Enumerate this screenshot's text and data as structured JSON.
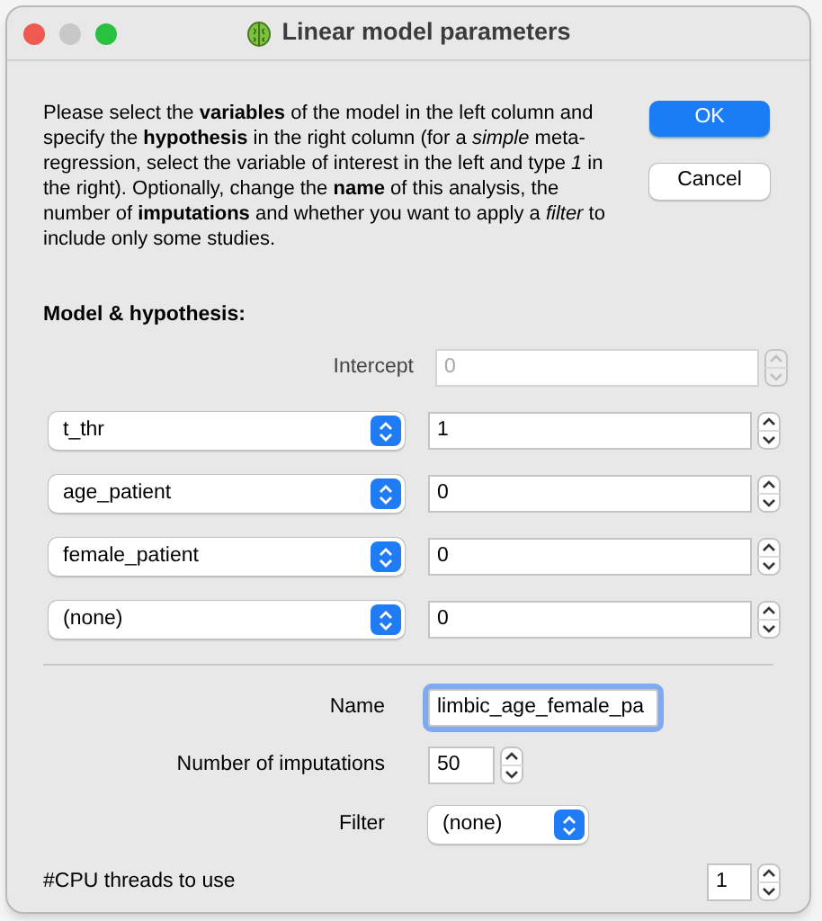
{
  "window": {
    "title": "Linear model parameters"
  },
  "description": "Please select the **variables** of the model in the left column and specify the **hypothesis** in the right column (for a *simple* meta-regression, select the variable of interest in the left and type *1* in the right). Optionally, change the **name** of this analysis, the number of **imputations** and whether you want to apply a *filter* to include only some studies.",
  "buttons": [
    {
      "label": "OK",
      "default": true
    },
    {
      "label": "Cancel",
      "default": false
    }
  ],
  "section_title": "Model & hypothesis:",
  "intercept": {
    "label": "Intercept",
    "value": "0",
    "disabled": true
  },
  "terms": [
    {
      "variable": "t_thr",
      "value": "1"
    },
    {
      "variable": "age_patient",
      "value": "0"
    },
    {
      "variable": "female_patient",
      "value": "0"
    },
    {
      "variable": "(none)",
      "value": "0"
    }
  ],
  "name": {
    "label": "Name",
    "value": "limbic_age_female_pa",
    "focused": true
  },
  "imputations": {
    "label": "Number of imputations",
    "value": "50"
  },
  "filter": {
    "label": "Filter",
    "value": "(none)"
  },
  "cpu_threads": {
    "label": "#CPU threads to use",
    "value": "1"
  }
}
